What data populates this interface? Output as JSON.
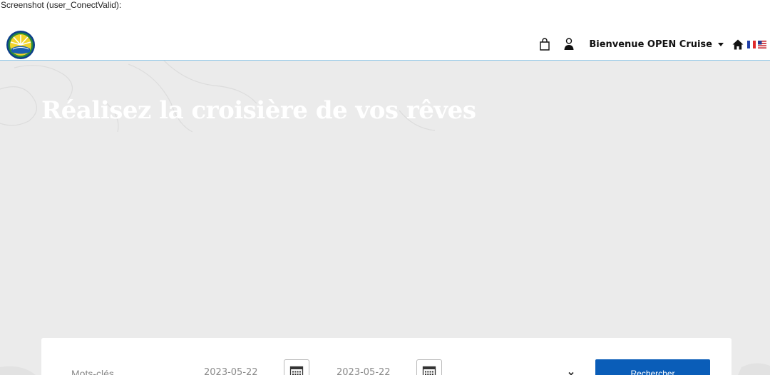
{
  "caption": "Screenshot (user_ConectValid):",
  "header": {
    "welcome_text": "Bienvenue OPEN Cruise",
    "icons": [
      "logo-icon",
      "shopping-bag-icon",
      "user-icon",
      "home-icon",
      "france-flag-icon",
      "us-flag-icon"
    ]
  },
  "hero": {
    "title": "Réalisez la croisière de vos rêves"
  },
  "search": {
    "keywords_placeholder": "Mots-clés",
    "start_date": "2023-05-22",
    "end_date": "2023-05-22",
    "submit_label": "Rechercher"
  },
  "colors": {
    "accent": "#0a5db8",
    "navbar_border": "#8ec7e8",
    "hero_bg": "#ebebeb"
  }
}
